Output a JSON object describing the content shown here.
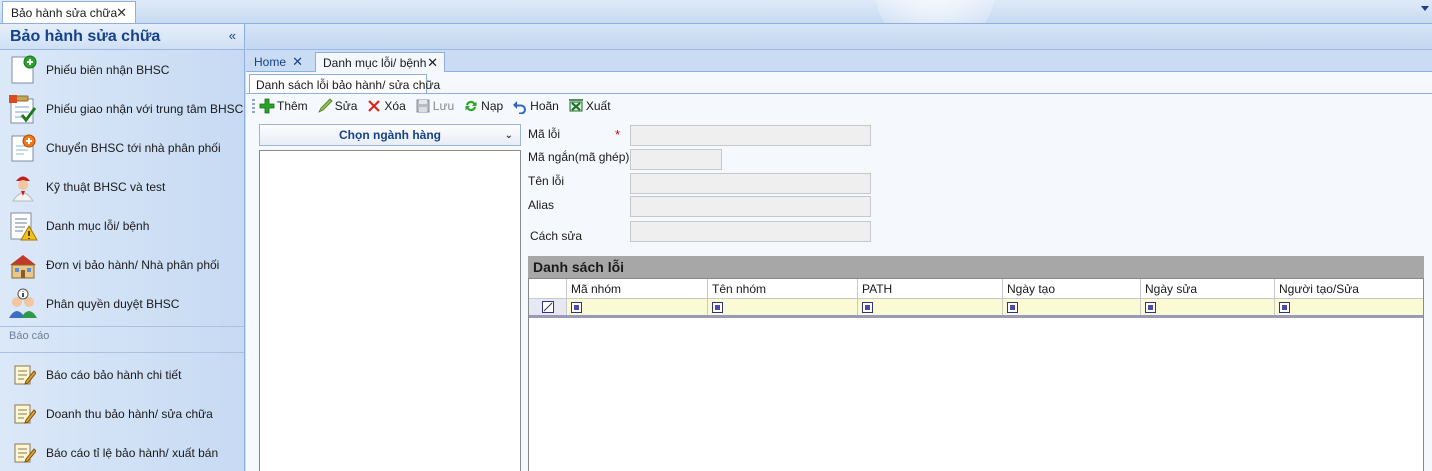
{
  "window": {
    "doc_tab_label": "Bảo hành sửa chữa",
    "doc_tab_close": "✕"
  },
  "sidebar": {
    "title": "Bảo hành sửa chữa",
    "collapse_glyph": "«",
    "items": [
      {
        "label": "Phiếu biên nhận BHSC",
        "icon": "document-add-icon"
      },
      {
        "label": "Phiếu giao nhận với trung tâm BHSC",
        "icon": "checklist-icon"
      },
      {
        "label": "Chuyển BHSC tới nhà phân phối",
        "icon": "document-forward-icon"
      },
      {
        "label": "Kỹ thuật BHSC và test",
        "icon": "technician-icon"
      },
      {
        "label": "Danh mục lỗi/ bệnh",
        "icon": "warning-document-icon"
      },
      {
        "label": "Đơn vị bảo hành/ Nhà phân phối",
        "icon": "building-icon"
      },
      {
        "label": "Phân quyền duyệt BHSC",
        "icon": "users-info-icon"
      }
    ],
    "group_label": "Báo cáo",
    "report_items": [
      {
        "label": "Báo cáo bảo hành chi tiết",
        "icon": "report-edit-icon"
      },
      {
        "label": "Doanh thu bảo hành/ sửa chữa",
        "icon": "report-edit-icon"
      },
      {
        "label": "Báo cáo tỉ lệ bảo hành/ xuất bán",
        "icon": "report-edit-icon"
      }
    ]
  },
  "tabs": {
    "home": "Home",
    "danh_muc": "Danh mục lỗi/ bệnh",
    "close_glyph": "✕"
  },
  "subtab": "Danh sách lỗi bảo hành/ sửa chữa",
  "toolbar": {
    "them": "Thêm",
    "sua": "Sửa",
    "xoa": "Xóa",
    "luu": "Lưu",
    "nap": "Nạp",
    "hoan": "Hoãn",
    "xuat": "Xuất"
  },
  "colors": {
    "accent": "#15428b",
    "required": "#d00000",
    "grid_title_bg": "#a7a7a7",
    "filter_row_bg": "#fafad5"
  },
  "combo": {
    "label": "Chọn ngành hàng",
    "chevron": "⌄"
  },
  "form": {
    "ma_loi": "Mã lỗi",
    "required_mark": "*",
    "ma_ngan": "Mã ngắn(mã ghép)",
    "ten_loi": "Tên lỗi",
    "alias": "Alias",
    "cach_sua": "Cách sửa"
  },
  "grid": {
    "title": "Danh sách lỗi",
    "columns": [
      "Mã nhóm",
      "Tên nhóm",
      "PATH",
      "Ngày tạo",
      "Ngày sửa",
      "Người tạo/Sửa"
    ]
  }
}
